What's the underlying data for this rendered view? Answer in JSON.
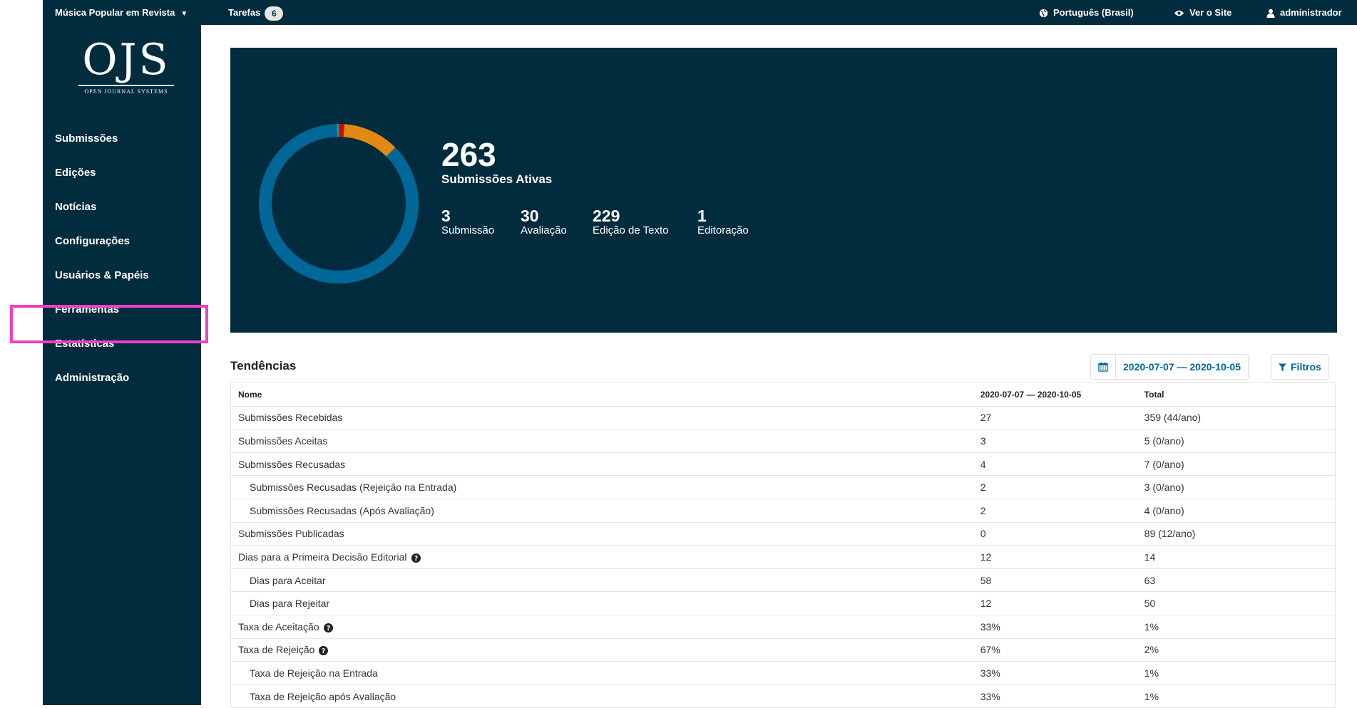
{
  "topbar": {
    "journal": "Música Popular em Revista",
    "tasks_label": "Tarefas",
    "tasks_count": "6",
    "language": "Português (Brasil)",
    "view_site": "Ver o Site",
    "user": "administrador"
  },
  "logo": {
    "big": "OJS",
    "small": "OPEN JOURNAL SYSTEMS"
  },
  "nav": {
    "items": [
      {
        "label": "Submissões"
      },
      {
        "label": "Edições"
      },
      {
        "label": "Notícias"
      },
      {
        "label": "Configurações"
      },
      {
        "label": "Usuários & Papéis"
      },
      {
        "label": "Ferramentas"
      },
      {
        "label": "Estatísticas"
      },
      {
        "label": "Administração"
      }
    ],
    "highlighted": "Estatísticas"
  },
  "hero": {
    "active_count": "263",
    "active_label": "Submissões Ativas",
    "stages": [
      {
        "count": "3",
        "label": "Submissão",
        "color": "#d00a0a"
      },
      {
        "count": "30",
        "label": "Avaliação",
        "color": "#e08914"
      },
      {
        "count": "229",
        "label": "Edição de Texto",
        "color": "#006798"
      },
      {
        "count": "1",
        "label": "Editoração",
        "color": "#00b28d"
      }
    ]
  },
  "trends": {
    "title": "Tendências",
    "date_range": "2020-07-07 — 2020-10-05",
    "filters_label": "Filtros",
    "columns": [
      "Nome",
      "2020-07-07 — 2020-10-05",
      "Total"
    ],
    "rows": [
      {
        "name": "Submissões Recebidas",
        "range": "27",
        "total": "359 (44/ano)"
      },
      {
        "name": "Submissões Aceitas",
        "range": "3",
        "total": "5 (0/ano)"
      },
      {
        "name": "Submissões Recusadas",
        "range": "4",
        "total": "7 (0/ano)"
      },
      {
        "name": "Submissões Recusadas (Rejeição na Entrada)",
        "range": "2",
        "total": "3 (0/ano)"
      },
      {
        "name": "Submissões Recusadas (Após Avaliação)",
        "range": "2",
        "total": "4 (0/ano)"
      },
      {
        "name": "Submissões Publicadas",
        "range": "0",
        "total": "89 (12/ano)"
      },
      {
        "name": "Dias para a Primeira Decisão Editorial",
        "range": "12",
        "total": "14"
      },
      {
        "name": "Dias para Aceitar",
        "range": "58",
        "total": "63"
      },
      {
        "name": "Dias para Rejeitar",
        "range": "12",
        "total": "50"
      },
      {
        "name": "Taxa de Aceitação",
        "range": "33%",
        "total": "1%"
      },
      {
        "name": "Taxa de Rejeição",
        "range": "67%",
        "total": "2%"
      },
      {
        "name": "Taxa de Rejeição na Entrada",
        "range": "33%",
        "total": "1%"
      },
      {
        "name": "Taxa de Rejeição após Avaliação",
        "range": "33%",
        "total": "1%"
      }
    ]
  }
}
